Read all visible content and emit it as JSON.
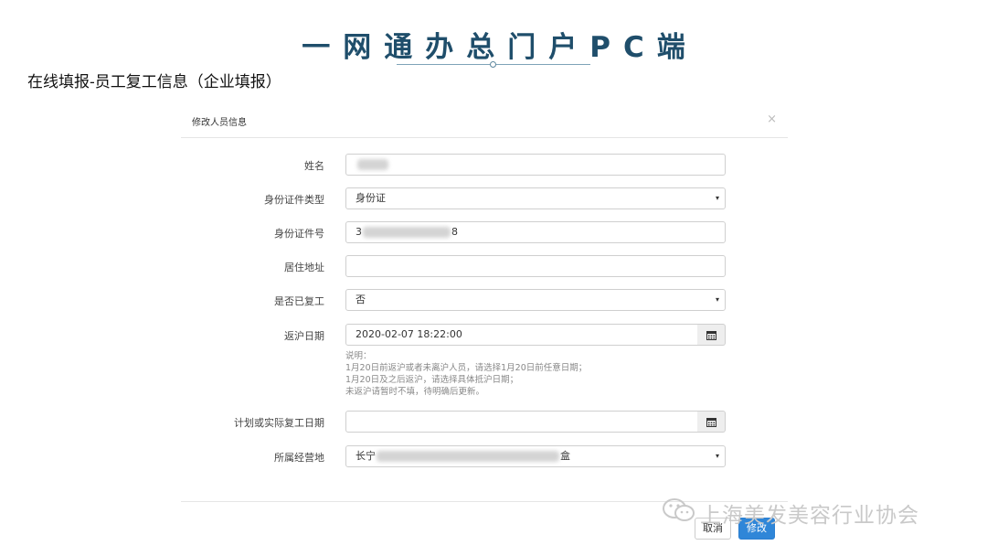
{
  "banner": {
    "title": "一网通办总门户PC端"
  },
  "page_subtitle": "在线填报-员工复工信息（企业填报）",
  "modal": {
    "title": "修改人员信息",
    "close_symbol": "×",
    "fields": {
      "name": {
        "label": "姓名"
      },
      "id_type": {
        "label": "身份证件类型",
        "value": "身份证"
      },
      "id_number": {
        "label": "身份证件号",
        "prefix": "3",
        "suffix": "8"
      },
      "address": {
        "label": "居住地址",
        "value": ""
      },
      "returned": {
        "label": "是否已复工",
        "value": "否"
      },
      "return_date": {
        "label": "返沪日期",
        "value": "2020-02-07 18:22:00"
      },
      "work_date": {
        "label": "计划或实际复工日期",
        "value": ""
      },
      "district": {
        "label": "所属经营地",
        "prefix": "长宁",
        "suffix": "盒"
      }
    },
    "note": {
      "line1": "说明：",
      "line2": "1月20日前返沪或者未离沪人员，请选择1月20日前任意日期；",
      "line3": "1月20日及之后返沪，请选择具体抵沪日期；",
      "line4": "未返沪请暂时不填，待明确后更新。"
    },
    "buttons": {
      "cancel": "取消",
      "modify": "修改"
    }
  },
  "watermark": {
    "text": "上海美发美容行业协会"
  },
  "icons": {
    "select_caret": "▾",
    "calendar": "calendar-icon",
    "wechat": "wechat-icon"
  },
  "colors": {
    "title": "#1f4e6b",
    "primary_button": "#2f86d8",
    "border": "#cfcfcf",
    "note_text": "#888888"
  }
}
